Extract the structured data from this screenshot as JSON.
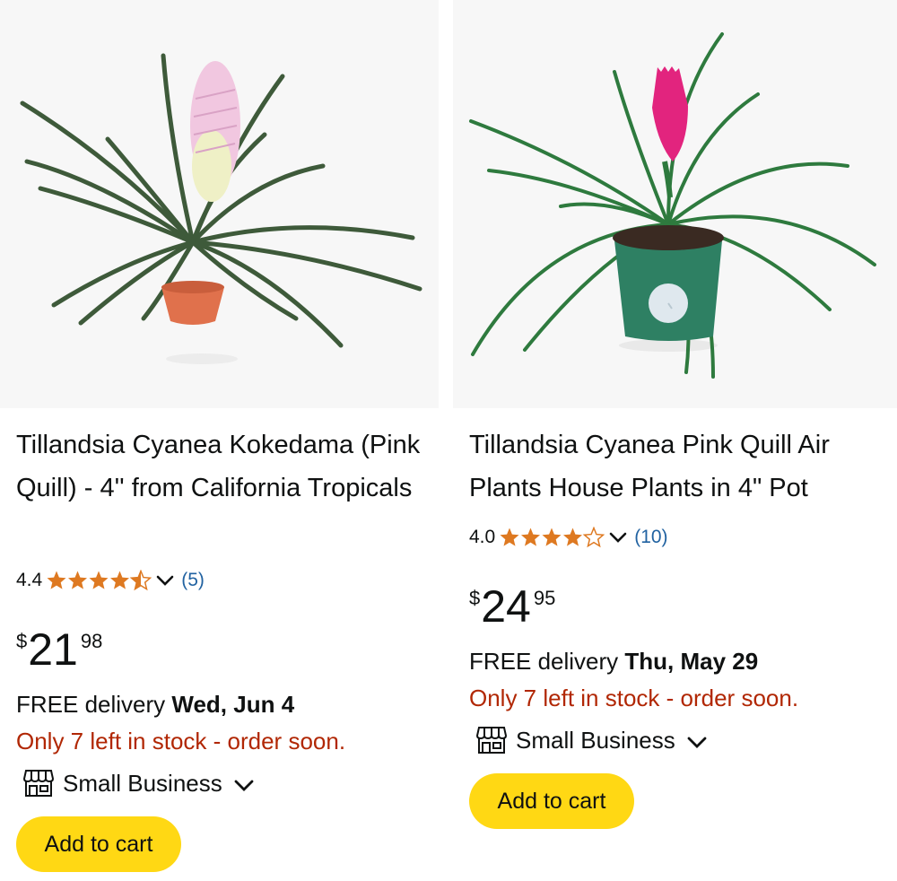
{
  "products": [
    {
      "title": "Tillandsia Cyanea Kokedama (Pink Quill) - 4'' from California Tropicals",
      "rating": "4.4",
      "stars": 4.5,
      "review_count": "(5)",
      "price_currency": "$",
      "price_whole": "21",
      "price_fraction": "98",
      "delivery_prefix": "FREE delivery ",
      "delivery_date": "Wed, Jun 4",
      "stock_note": "Only 7 left in stock - order soon.",
      "badge": "Small Business",
      "add_to_cart": "Add to cart",
      "image": "pink-quill-plant-orange-pot"
    },
    {
      "title": "Tillandsia Cyanea Pink Quill Air Plants House Plants in 4\" Pot",
      "rating": "4.0",
      "stars": 4,
      "review_count": "(10)",
      "price_currency": "$",
      "price_whole": "24",
      "price_fraction": "95",
      "delivery_prefix": "FREE delivery ",
      "delivery_date": "Thu, May 29",
      "stock_note": "Only 7 left in stock - order soon.",
      "badge": "Small Business",
      "add_to_cart": "Add to cart",
      "image": "pink-quill-plant-green-pot"
    }
  ],
  "colors": {
    "star": "#de7921",
    "link": "#2162a1",
    "stock": "#b12704",
    "button": "#ffd814",
    "text": "#0f1111"
  }
}
